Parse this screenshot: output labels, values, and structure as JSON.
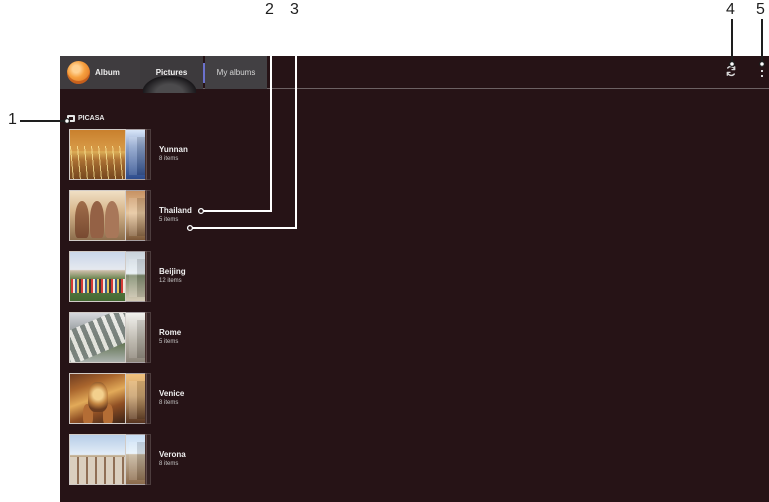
{
  "callouts": {
    "one": "1",
    "two": "2",
    "three": "3",
    "four": "4",
    "five": "5"
  },
  "toolbar": {
    "album_label": "Album",
    "pictures_label": "Pictures",
    "my_albums_label": "My albums"
  },
  "section": {
    "label": "PICASA"
  },
  "albums": [
    {
      "title": "Yunnan",
      "count": "8 items"
    },
    {
      "title": "Thailand",
      "count": "5 items"
    },
    {
      "title": "Beijing",
      "count": "12 items"
    },
    {
      "title": "Rome",
      "count": "5 items"
    },
    {
      "title": "Venice",
      "count": "8 items"
    },
    {
      "title": "Verona",
      "count": "8 items"
    }
  ],
  "icons": {
    "album": "album-icon",
    "pictures_indicator": "selected-tab-indicator",
    "sync": "sync-icon",
    "overflow": "overflow-menu-icon",
    "picasa": "picasa-icon"
  },
  "colors": {
    "background": "#261316",
    "toolbar": "#3f3c3f",
    "tab_divider": "#6b71cc",
    "album_accent": "#f6a03f",
    "callout_lines": "#1e1e1e",
    "callout_line_white": "#ffffff"
  }
}
